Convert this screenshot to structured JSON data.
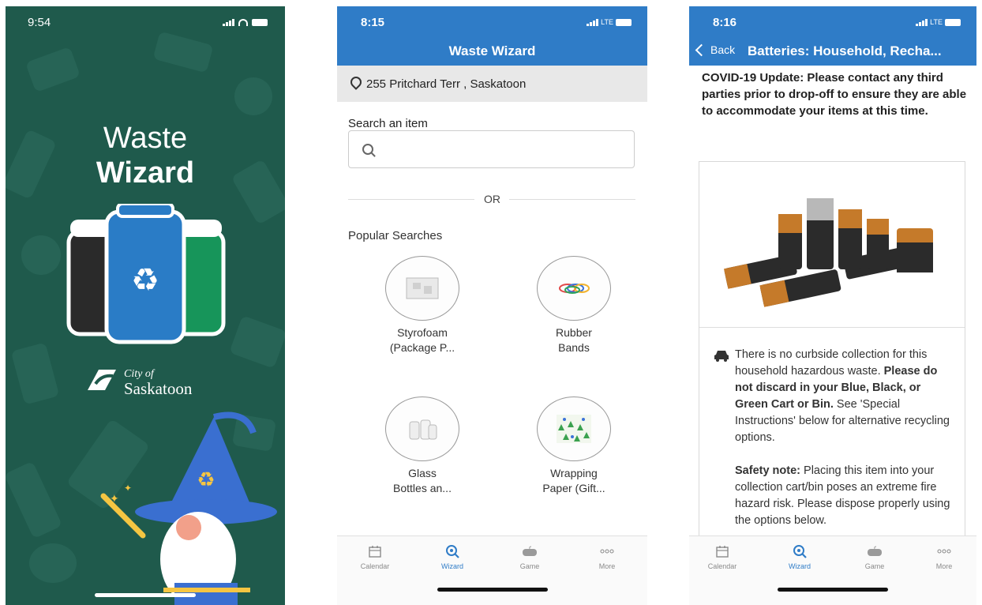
{
  "screen1": {
    "status_time": "9:54",
    "title_line1": "Waste",
    "title_line2": "Wizard",
    "logo_small": "City of",
    "logo_big": "Saskatoon"
  },
  "screen2": {
    "status_time": "8:15",
    "network": "LTE",
    "header_title": "Waste Wizard",
    "location": "255 Pritchard Terr , Saskatoon",
    "search_label": "Search an item",
    "search_placeholder": "",
    "or_text": "OR",
    "popular_title": "Popular Searches",
    "items": [
      {
        "line1": "Styrofoam",
        "line2": "(Package P..."
      },
      {
        "line1": "Rubber",
        "line2": "Bands"
      },
      {
        "line1": "Glass",
        "line2": "Bottles an..."
      },
      {
        "line1": "Wrapping",
        "line2": "Paper (Gift..."
      }
    ]
  },
  "screen3": {
    "status_time": "8:16",
    "network": "LTE",
    "back_label": "Back",
    "header_title": "Batteries: Household, Recha...",
    "covid": "COVID-19 Update: Please contact any third parties prior to drop-off to ensure they are able to accommodate your items at this time.",
    "note_plain1": "There is no curbside collection for this household hazardous waste. ",
    "note_bold1": "Please do not discard in your Blue, Black, or Green Cart or Bin.",
    "note_plain2": " See 'Special Instructions' below for alternative recycling options.",
    "safety_bold": "Safety note:",
    "safety_plain": " Placing this item into your collection cart/bin poses an extreme fire hazard risk. Please dispose properly using the options below."
  },
  "tabs": {
    "calendar": "Calendar",
    "wizard": "Wizard",
    "game": "Game",
    "more": "More"
  },
  "colors": {
    "splash_green": "#1f5a4c",
    "header_blue": "#2f7cc7",
    "bin_black": "#2a2a2a",
    "bin_blue": "#2a7cc6",
    "bin_green": "#17955a"
  }
}
